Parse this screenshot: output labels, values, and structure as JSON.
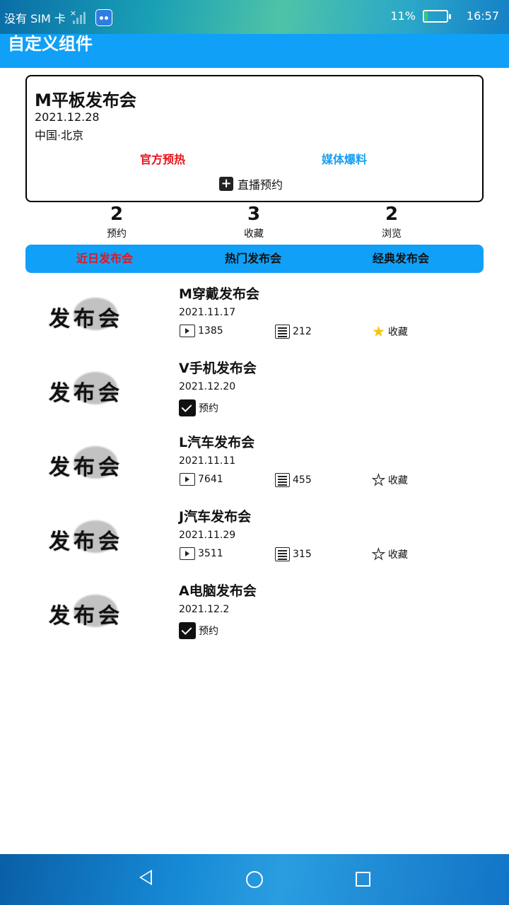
{
  "status_bar": {
    "carrier": "没有 SIM 卡",
    "battery_percent": "11%",
    "time": "16:57",
    "battery_level": 0.11,
    "battery_fill_color": "#35d44a"
  },
  "app": {
    "title": "自定义组件",
    "accent": "#10a0f8"
  },
  "featured": {
    "name": "M平板发布会",
    "date": "2021.12.28",
    "location": "中国·北京",
    "link_official": "官方预热",
    "link_media": "媒体爆料",
    "live_reserve": "直播预约",
    "link_official_color": "#e8141b",
    "link_media_color": "#18a0f0"
  },
  "stats": [
    {
      "value": "2",
      "label": "预约"
    },
    {
      "value": "3",
      "label": "收藏"
    },
    {
      "value": "2",
      "label": "浏览"
    }
  ],
  "tabs": [
    {
      "label": "近日发布会",
      "active": true
    },
    {
      "label": "热门发布会",
      "active": false
    },
    {
      "label": "经典发布会",
      "active": false
    }
  ],
  "thumb_text": "发布会",
  "items": [
    {
      "title": "M穿戴发布会",
      "date": "2021.11.17",
      "views": "1385",
      "comments": "212",
      "fav_label": "收藏",
      "favorited": true
    },
    {
      "title": "V手机发布会",
      "date": "2021.12.20",
      "reserve_label": "预约",
      "reserved": true
    },
    {
      "title": "L汽车发布会",
      "date": "2021.11.11",
      "views": "7641",
      "comments": "455",
      "fav_label": "收藏",
      "favorited": false
    },
    {
      "title": "J汽车发布会",
      "date": "2021.11.29",
      "views": "3511",
      "comments": "315",
      "fav_label": "收藏",
      "favorited": false
    },
    {
      "title": "A电脑发布会",
      "date": "2021.12.2",
      "reserve_label": "预约",
      "reserved": true
    }
  ]
}
